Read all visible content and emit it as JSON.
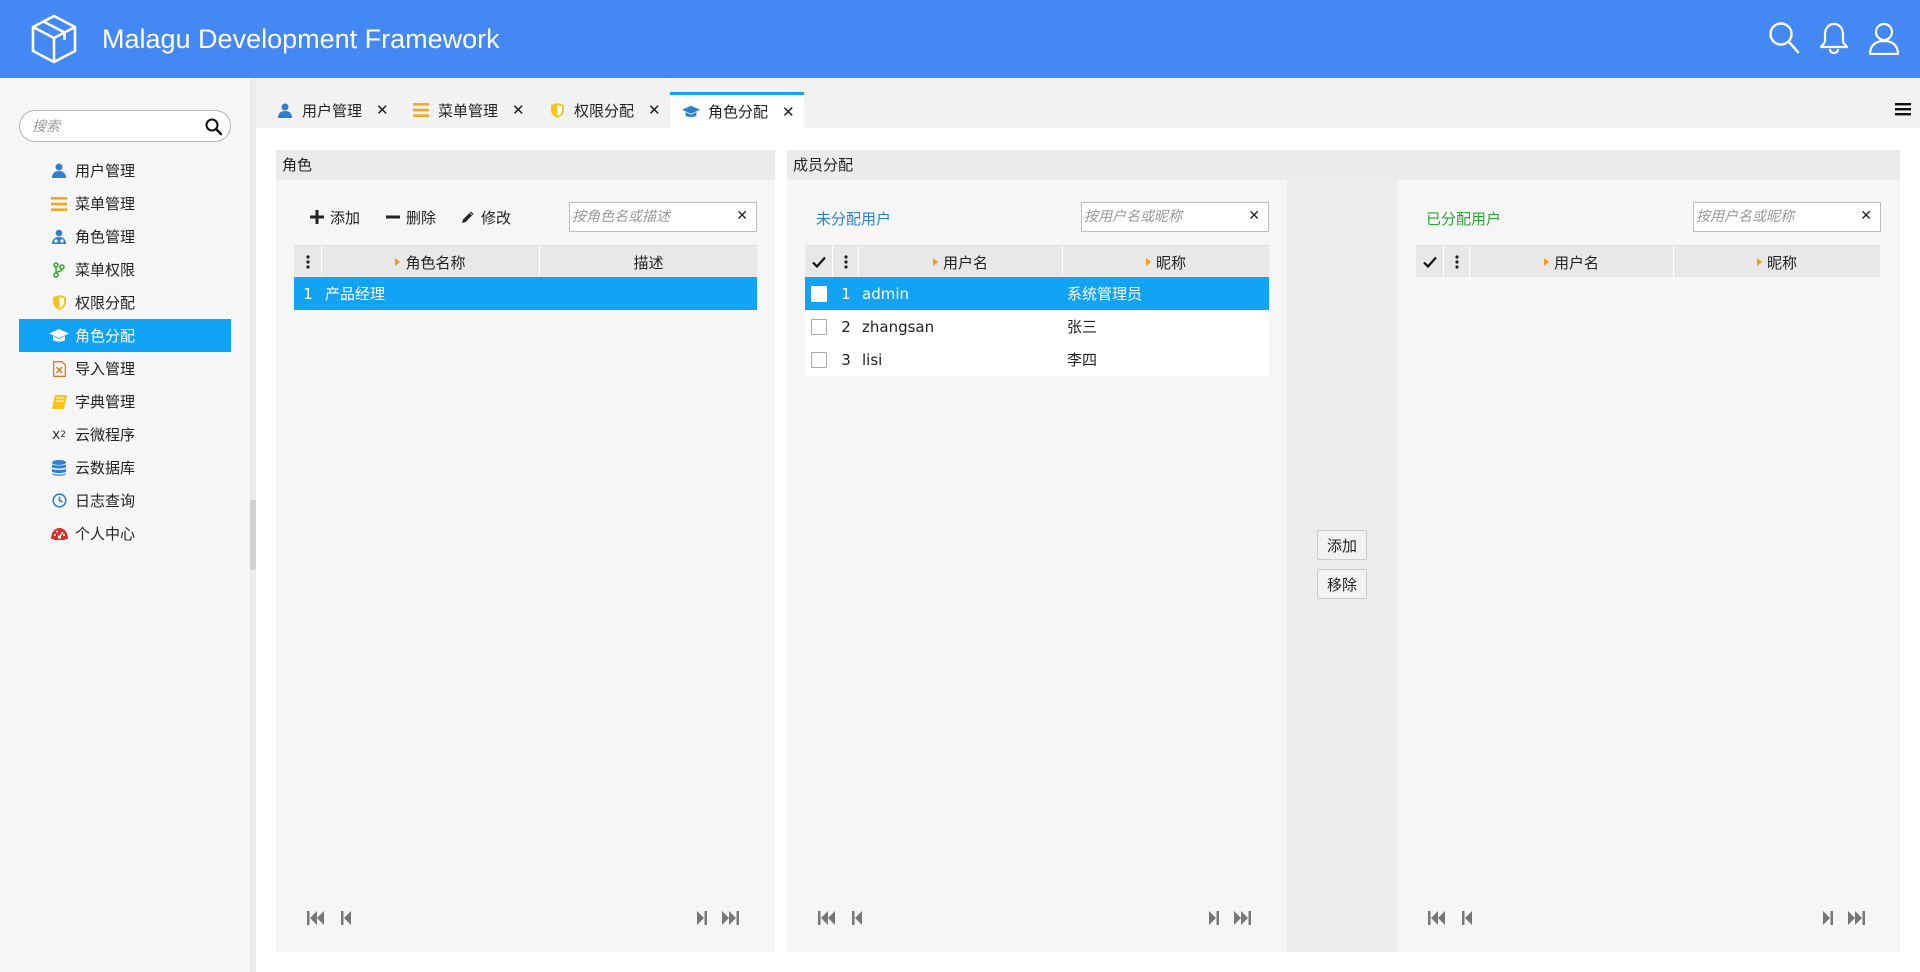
{
  "header": {
    "title": "Malagu Development Framework",
    "icons": [
      "cube-logo-icon",
      "search-icon",
      "bell-icon",
      "user-icon"
    ]
  },
  "sidebar": {
    "search_placeholder": "搜索",
    "items": [
      {
        "label": "用户管理",
        "icon": "user-icon",
        "color": "#2f7fd1"
      },
      {
        "label": "菜单管理",
        "icon": "bars-icon",
        "color": "#f5a623"
      },
      {
        "label": "角色管理",
        "icon": "users-icon",
        "color": "#2f7fd1"
      },
      {
        "label": "菜单权限",
        "icon": "branch-icon",
        "color": "#3aaa35"
      },
      {
        "label": "权限分配",
        "icon": "shield-icon",
        "color": "#f5c518"
      },
      {
        "label": "角色分配",
        "icon": "graduation-cap-icon",
        "color": "#ffffff"
      },
      {
        "label": "导入管理",
        "icon": "excel-file-icon",
        "color": "#e8731c"
      },
      {
        "label": "字典管理",
        "icon": "book-icon",
        "color": "#f5c518"
      },
      {
        "label": "云微程序",
        "icon": "superscript-icon",
        "color": "#333333"
      },
      {
        "label": "云数据库",
        "icon": "database-icon",
        "color": "#2f7fd1"
      },
      {
        "label": "日志查询",
        "icon": "clock-icon",
        "color": "#2f7fd1"
      },
      {
        "label": "个人中心",
        "icon": "dashboard-icon",
        "color": "#d9302c"
      }
    ],
    "active_index": 5
  },
  "tabs": [
    {
      "label": "用户管理",
      "icon": "user-icon"
    },
    {
      "label": "菜单管理",
      "icon": "bars-icon"
    },
    {
      "label": "权限分配",
      "icon": "shield-icon"
    },
    {
      "label": "角色分配",
      "icon": "graduation-cap-icon",
      "active": true
    }
  ],
  "role_panel": {
    "title": "角色",
    "toolbar": {
      "add": "添加",
      "delete": "删除",
      "edit": "修改"
    },
    "filter_placeholder": "按角色名或描述",
    "columns": [
      "角色名称",
      "描述"
    ],
    "rows": [
      {
        "index": "1",
        "name": "产品经理",
        "desc": ""
      }
    ]
  },
  "member_panel": {
    "title": "成员分配",
    "unassigned": {
      "title": "未分配用户",
      "title_color": "#2a82d0",
      "filter_placeholder": "按用户名或昵称",
      "columns": [
        "用户名",
        "昵称"
      ],
      "rows": [
        {
          "index": "1",
          "username": "admin",
          "nickname": "系统管理员",
          "selected": true
        },
        {
          "index": "2",
          "username": "zhangsan",
          "nickname": "张三"
        },
        {
          "index": "3",
          "username": "lisi",
          "nickname": "李四"
        }
      ]
    },
    "actions": {
      "add": "添加",
      "remove": "移除"
    },
    "assigned": {
      "title": "已分配用户",
      "title_color": "#27a836",
      "filter_placeholder": "按用户名或昵称",
      "columns": [
        "用户名",
        "昵称"
      ],
      "rows": []
    }
  },
  "colors": {
    "header": "#4488f4",
    "accent": "#12a3f5",
    "sort_arrow": "#f39c1b"
  }
}
